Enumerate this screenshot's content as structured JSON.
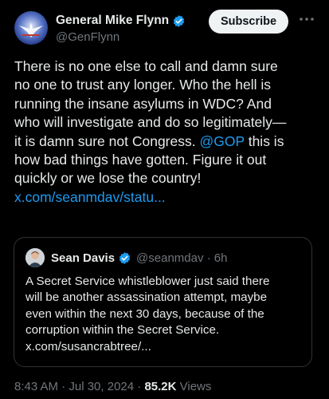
{
  "author": {
    "display_name": "General Mike Flynn",
    "handle": "@GenFlynn",
    "verified": true
  },
  "subscribe_label": "Subscribe",
  "more_icon": "more-horizontal-icon",
  "tweet": {
    "lines": [
      "There is no one else to call and damn sure",
      "no one to trust any longer. Who the hell is",
      "running the insane asylums in WDC? And",
      "who will investigate and do so legitimately—",
      "it is damn sure not Congress."
    ],
    "mention": "@GOP",
    "line6_after_mention": " this is",
    "line7": "how bad things have gotten. Figure it out",
    "line8": "quickly or we lose the country!",
    "link": "x.com/seanmdav/statu..."
  },
  "quote": {
    "display_name": "Sean Davis",
    "handle_time": "@seanmdav · 6h",
    "verified": true,
    "lines": [
      "A Secret Service whistleblower just said there",
      "will be another assassination attempt, maybe",
      "even within the next 30 days, because of the",
      "corruption within the Secret Service.",
      "x.com/susancrabtree/..."
    ]
  },
  "meta": {
    "timestamp": "8:43 AM · Jul 30, 2024 · ",
    "views_count": "85.2K",
    "views_label": " Views"
  },
  "colors": {
    "background": "#000000",
    "text": "#e7e9ea",
    "secondary": "#71767b",
    "link": "#1d9bf0",
    "verified": "#1d9bf0"
  }
}
